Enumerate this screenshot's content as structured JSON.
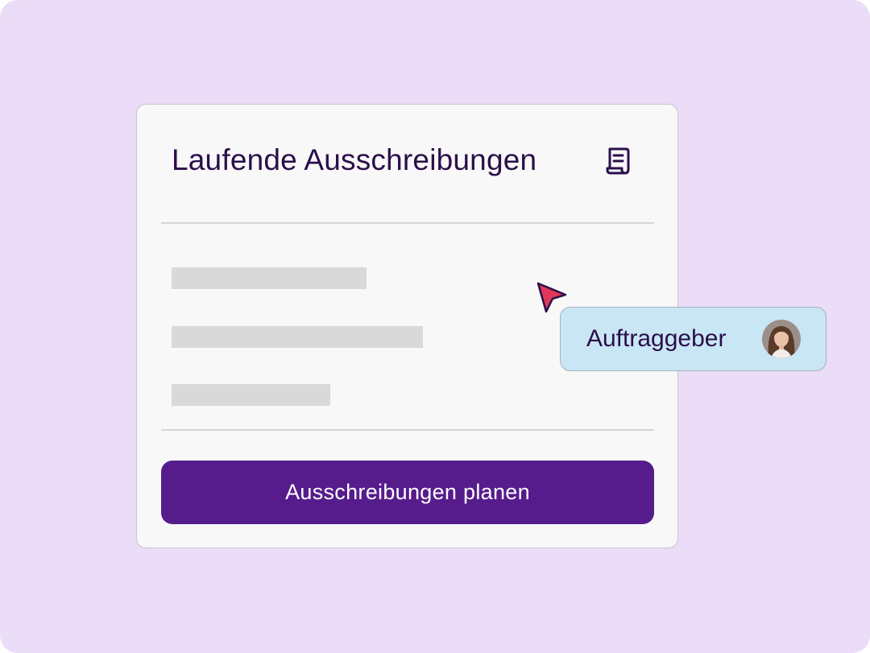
{
  "card": {
    "title": "Laufende Ausschreibungen",
    "title_icon": "document-icon",
    "placeholder_rows": 3,
    "button_label": "Ausschreibungen planen"
  },
  "role_chip": {
    "label": "Auftraggeber",
    "avatar": "avatar"
  },
  "cursor_icon": "cursor-arrow-icon",
  "colors": {
    "background": "#ebdcf7",
    "card": "#f8f8f8",
    "title_text": "#2a0f4a",
    "button": "#561c8c",
    "button_text": "#ffffff",
    "chip": "#c9e6f5",
    "cursor": "#e0375a",
    "skeleton": "#d9d9d9"
  }
}
